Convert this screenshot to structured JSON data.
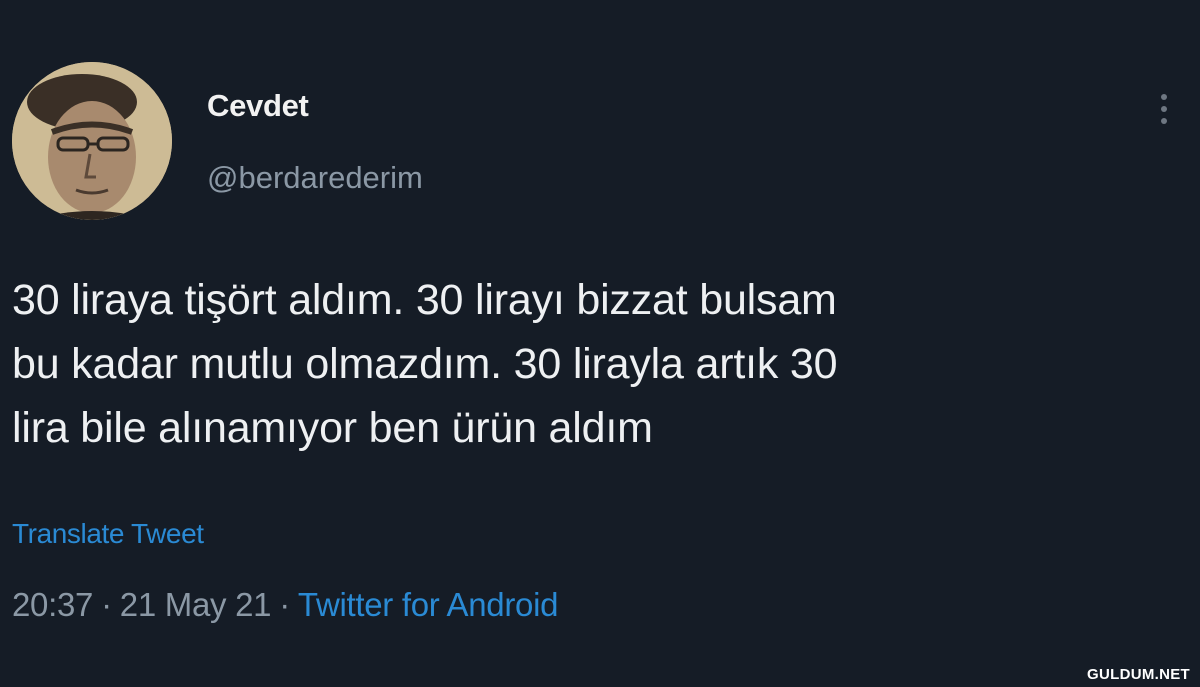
{
  "author": {
    "display_name": "Cevdet",
    "handle": "@berdarederim"
  },
  "tweet": {
    "text_lines": [
      "30 liraya tişört aldım. 30 lirayı bizzat bulsam",
      "bu kadar mutlu olmazdım. 30 lirayla artık 30",
      "lira bile alınamıyor ben ürün aldım"
    ],
    "translate_label": "Translate Tweet",
    "time": "20:37",
    "date": "21 May 21",
    "separator": "·",
    "source": "Twitter for Android"
  },
  "icons": {
    "more": "more-vertical-icon",
    "avatar": "profile-photo"
  },
  "watermark": "GULDUM.NET",
  "colors": {
    "background": "#151c26",
    "text": "#eef0f2",
    "muted": "#8b98a5",
    "link": "#2a8ad4"
  }
}
